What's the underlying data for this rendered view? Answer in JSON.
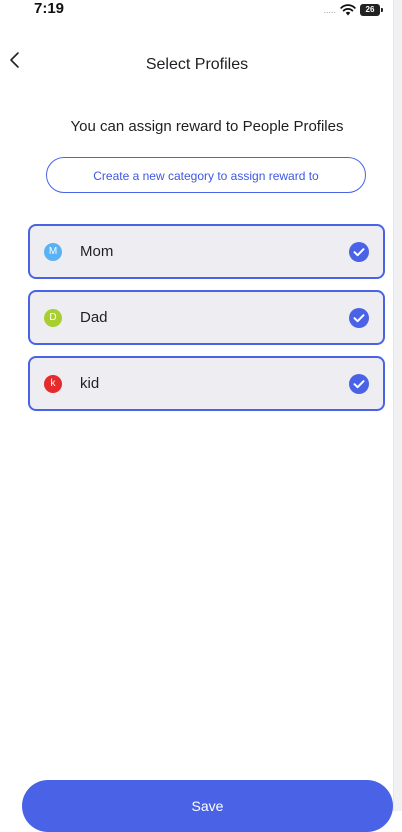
{
  "status_bar": {
    "time": "7:19",
    "signal": ".....",
    "battery": "26"
  },
  "header": {
    "back_icon": "chevron-left-icon",
    "title": "Select Profiles"
  },
  "subtitle": "You can assign reward to People Profiles",
  "create_category_label": "Create a new category to assign reward to",
  "profiles": [
    {
      "initial": "M",
      "name": "Mom",
      "avatar_color": "#5ab2f5",
      "selected": true
    },
    {
      "initial": "D",
      "name": "Dad",
      "avatar_color": "#a8cf2e",
      "selected": true
    },
    {
      "initial": "k",
      "name": "kid",
      "avatar_color": "#e52b2b",
      "selected": true
    }
  ],
  "save_label": "Save",
  "colors": {
    "accent": "#4a63e6",
    "item_background": "#eeeef2"
  }
}
